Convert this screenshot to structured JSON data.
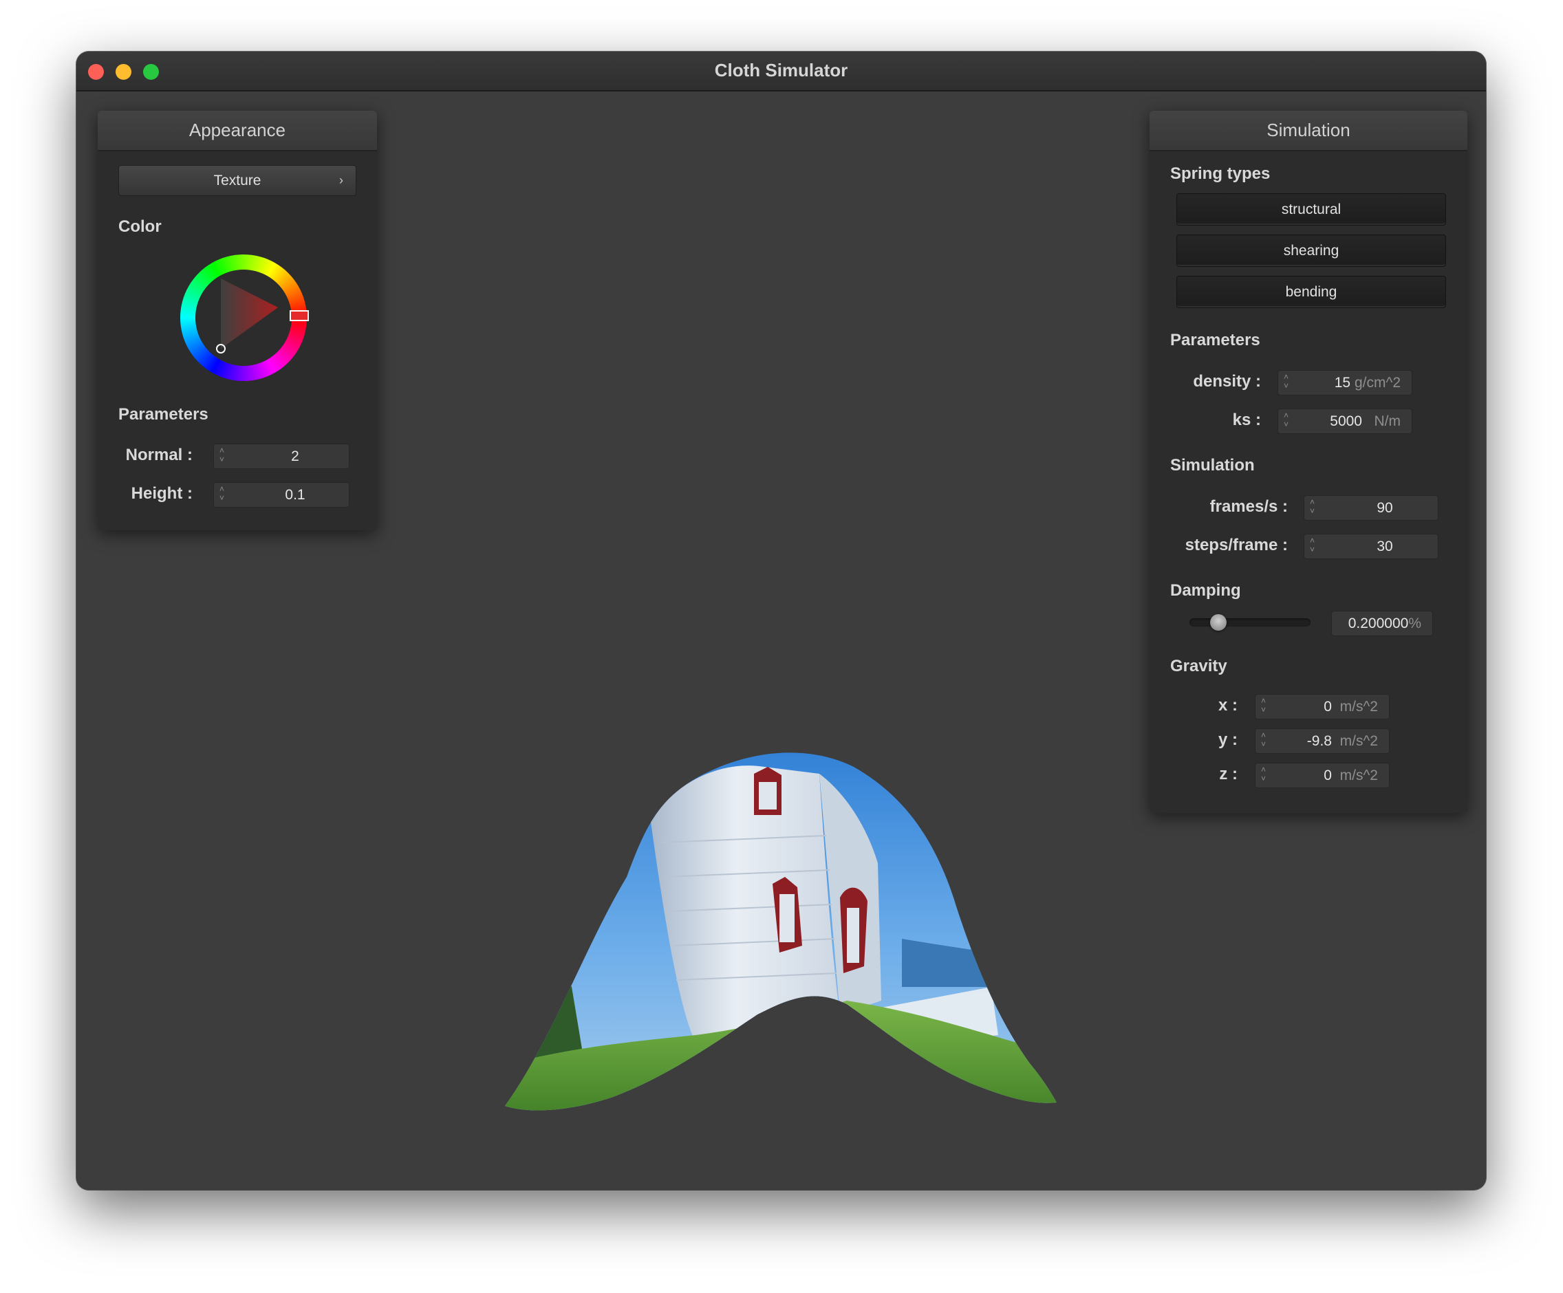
{
  "window": {
    "title": "Cloth Simulator"
  },
  "appearance": {
    "header": "Appearance",
    "texture_button": "Texture",
    "color_label": "Color",
    "color_value": "#e52b2b",
    "parameters_label": "Parameters",
    "normal": {
      "label": "Normal :",
      "value": "2"
    },
    "height": {
      "label": "Height :",
      "value": "0.1"
    }
  },
  "simulation_panel": {
    "header": "Simulation",
    "spring_types_label": "Spring types",
    "springs": [
      "structural",
      "shearing",
      "bending"
    ],
    "parameters_label": "Parameters",
    "density": {
      "label": "density :",
      "value": "15",
      "unit": "g/cm^2"
    },
    "ks": {
      "label": "ks :",
      "value": "5000",
      "unit": "N/m"
    },
    "simulation_label": "Simulation",
    "frames": {
      "label": "frames/s :",
      "value": "90"
    },
    "steps": {
      "label": "steps/frame :",
      "value": "30"
    },
    "damping_label": "Damping",
    "damping": {
      "value": "0.200000",
      "unit": "%",
      "slider_fraction": 0.2
    },
    "gravity_label": "Gravity",
    "gravity": {
      "x": {
        "label": "x :",
        "value": "0",
        "unit": "m/s^2"
      },
      "y": {
        "label": "y :",
        "value": "-9.8",
        "unit": "m/s^2"
      },
      "z": {
        "label": "z :",
        "value": "0",
        "unit": "m/s^2"
      }
    }
  }
}
